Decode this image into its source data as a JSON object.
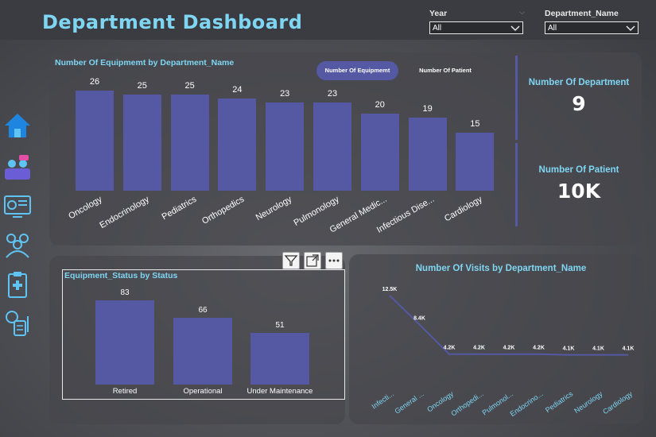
{
  "header": {
    "title": "Department Dashboard"
  },
  "filters": {
    "year": {
      "label": "Year",
      "value": "All"
    },
    "department": {
      "label": "Department_Name",
      "value": "All"
    }
  },
  "nav": {
    "items": [
      "home-icon",
      "team-icon",
      "monitor-analytics-icon",
      "doctors-icon",
      "medical-clipboard-icon",
      "patient-record-icon"
    ]
  },
  "equipment_chart": {
    "title": "Number Of Equipmemt by Department_Name",
    "toggle_active": "Number Of Equipmemt",
    "toggle_inactive": "Number Of Patient"
  },
  "kpis": {
    "departments": {
      "label": "Number Of Department",
      "value": "9"
    },
    "patients": {
      "label": "Number Of Patient",
      "value": "10K"
    }
  },
  "status_chart": {
    "title": "Equipment_Status by Status"
  },
  "visits_chart": {
    "title": "Number Of Visits by Department_Name"
  },
  "colors": {
    "bar": "#5558a3",
    "accent": "#7fd6f3"
  },
  "chart_data": [
    {
      "type": "bar",
      "title": "Number Of Equipmemt by Department_Name",
      "categories": [
        "Oncology",
        "Endocrinology",
        "Pediatrics",
        "Orthopedics",
        "Neurology",
        "Pulmonology",
        "General Medic...",
        "Infectious Dise...",
        "Cardiology"
      ],
      "values": [
        26,
        25,
        25,
        24,
        23,
        23,
        20,
        19,
        15
      ],
      "data_labels": [
        "26",
        "25",
        "25",
        "24",
        "23",
        "23",
        "20",
        "19",
        "15"
      ],
      "ylim": [
        0,
        26
      ],
      "grid": false
    },
    {
      "type": "bar",
      "title": "Equipment_Status by Status",
      "categories": [
        "Retired",
        "Operational",
        "Under Maintenance"
      ],
      "values": [
        83,
        66,
        51
      ],
      "data_labels": [
        "83",
        "66",
        "51"
      ],
      "ylim": [
        0,
        83
      ],
      "grid": false
    },
    {
      "type": "line",
      "title": "Number Of Visits by Department_Name",
      "categories": [
        "Infecti...",
        "General ...",
        "Oncology",
        "Orthopedi...",
        "Pulmonol...",
        "Endocrino...",
        "Pediatrics",
        "Neurology",
        "Cardiology"
      ],
      "values": [
        12500,
        8400,
        4200,
        4200,
        4200,
        4200,
        4100,
        4100,
        4100
      ],
      "data_labels": [
        "12.5K",
        "8.4K",
        "4.2K",
        "4.2K",
        "4.2K",
        "4.2K",
        "4.1K",
        "4.1K",
        "4.1K"
      ],
      "grid": false
    }
  ]
}
